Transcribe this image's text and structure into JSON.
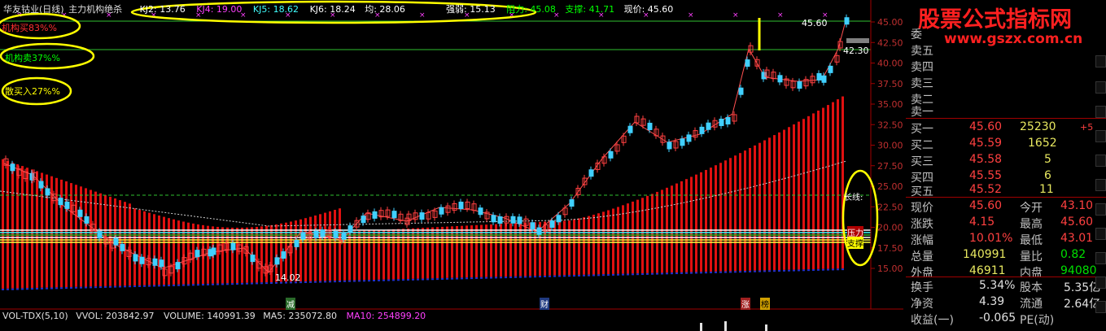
{
  "header": {
    "stock": "华友钴业(日线)",
    "indicator": "主力机构绝杀",
    "kj2": "KJ2: 13.76",
    "kj4": "KJ4: 19.00",
    "kj5": "KJ5: 18.62",
    "kj6": "KJ6: 18.24",
    "avg": "均: 28.06",
    "strength": "强弱: 15.13",
    "resistance": "阻力: 45.08",
    "support": "支撑: 41.71",
    "price": "现价: 45.60"
  },
  "left_labels": {
    "inst_buy": "机构买83%%",
    "inst_sell": "机构卖37%%",
    "retail_buy": "散买入27%%"
  },
  "chart_labels": {
    "high": "45.60",
    "level": "42.30",
    "low": "14.02",
    "long_line": "长线:",
    "pressure": "压力",
    "support_zone": "支撑",
    "event1": "减",
    "event2": "财",
    "event3": "涨",
    "event4": "榜"
  },
  "y_axis": [
    "45.00",
    "42.50",
    "40.00",
    "37.50",
    "35.00",
    "32.50",
    "30.00",
    "27.50",
    "25.00",
    "22.50",
    "20.00",
    "17.50",
    "15.00"
  ],
  "volume_bar": {
    "name": "VOL-TDX(5,10)",
    "vvol": "VVOL: 203842.97",
    "volume": "VOLUME: 140991.39",
    "ma5": "MA5: 235072.80",
    "ma10": "MA10: 254899.20"
  },
  "order_book": {
    "sell_partial": "委",
    "sells": [
      {
        "label": "卖五"
      },
      {
        "label": "卖四"
      },
      {
        "label": "卖三"
      },
      {
        "label": "卖二"
      },
      {
        "label": "卖一"
      }
    ],
    "buys": [
      {
        "label": "买一",
        "price": "45.60",
        "qty": "25230",
        "chg": "+5"
      },
      {
        "label": "买二",
        "price": "45.59",
        "qty": "1652",
        "chg": ""
      },
      {
        "label": "买三",
        "price": "45.58",
        "qty": "5",
        "chg": ""
      },
      {
        "label": "买四",
        "price": "45.55",
        "qty": "6",
        "chg": ""
      },
      {
        "label": "买五",
        "price": "45.52",
        "qty": "11",
        "chg": ""
      }
    ]
  },
  "quote": [
    {
      "l1": "现价",
      "v1": "45.60",
      "l2": "今开",
      "v2": "43.10"
    },
    {
      "l1": "涨跌",
      "v1": "4.15",
      "l2": "最高",
      "v2": "45.60"
    },
    {
      "l1": "涨幅",
      "v1": "10.01%",
      "l2": "最低",
      "v2": "43.01"
    },
    {
      "l1": "总量",
      "v1": "140991",
      "l2": "量比",
      "v2": "0.82"
    },
    {
      "l1": "外盘",
      "v1": "46911",
      "l2": "内盘",
      "v2": "94080"
    }
  ],
  "fundamentals": [
    {
      "l1": "换手",
      "v1": "5.34%",
      "l2": "股本",
      "v2": "5.35亿"
    },
    {
      "l1": "净资",
      "v1": "4.39",
      "l2": "流通",
      "v2": "2.64亿"
    },
    {
      "l1": "收益(一)",
      "v1": "-0.065",
      "l2": "PE(动)",
      "v2": ""
    }
  ],
  "watermark": {
    "title": "股票公式指标网",
    "url": "www.gszx.com.cn"
  },
  "colors": {
    "up": "#ff3030",
    "down": "#30d0ff",
    "annotation": "#ffff00"
  }
}
